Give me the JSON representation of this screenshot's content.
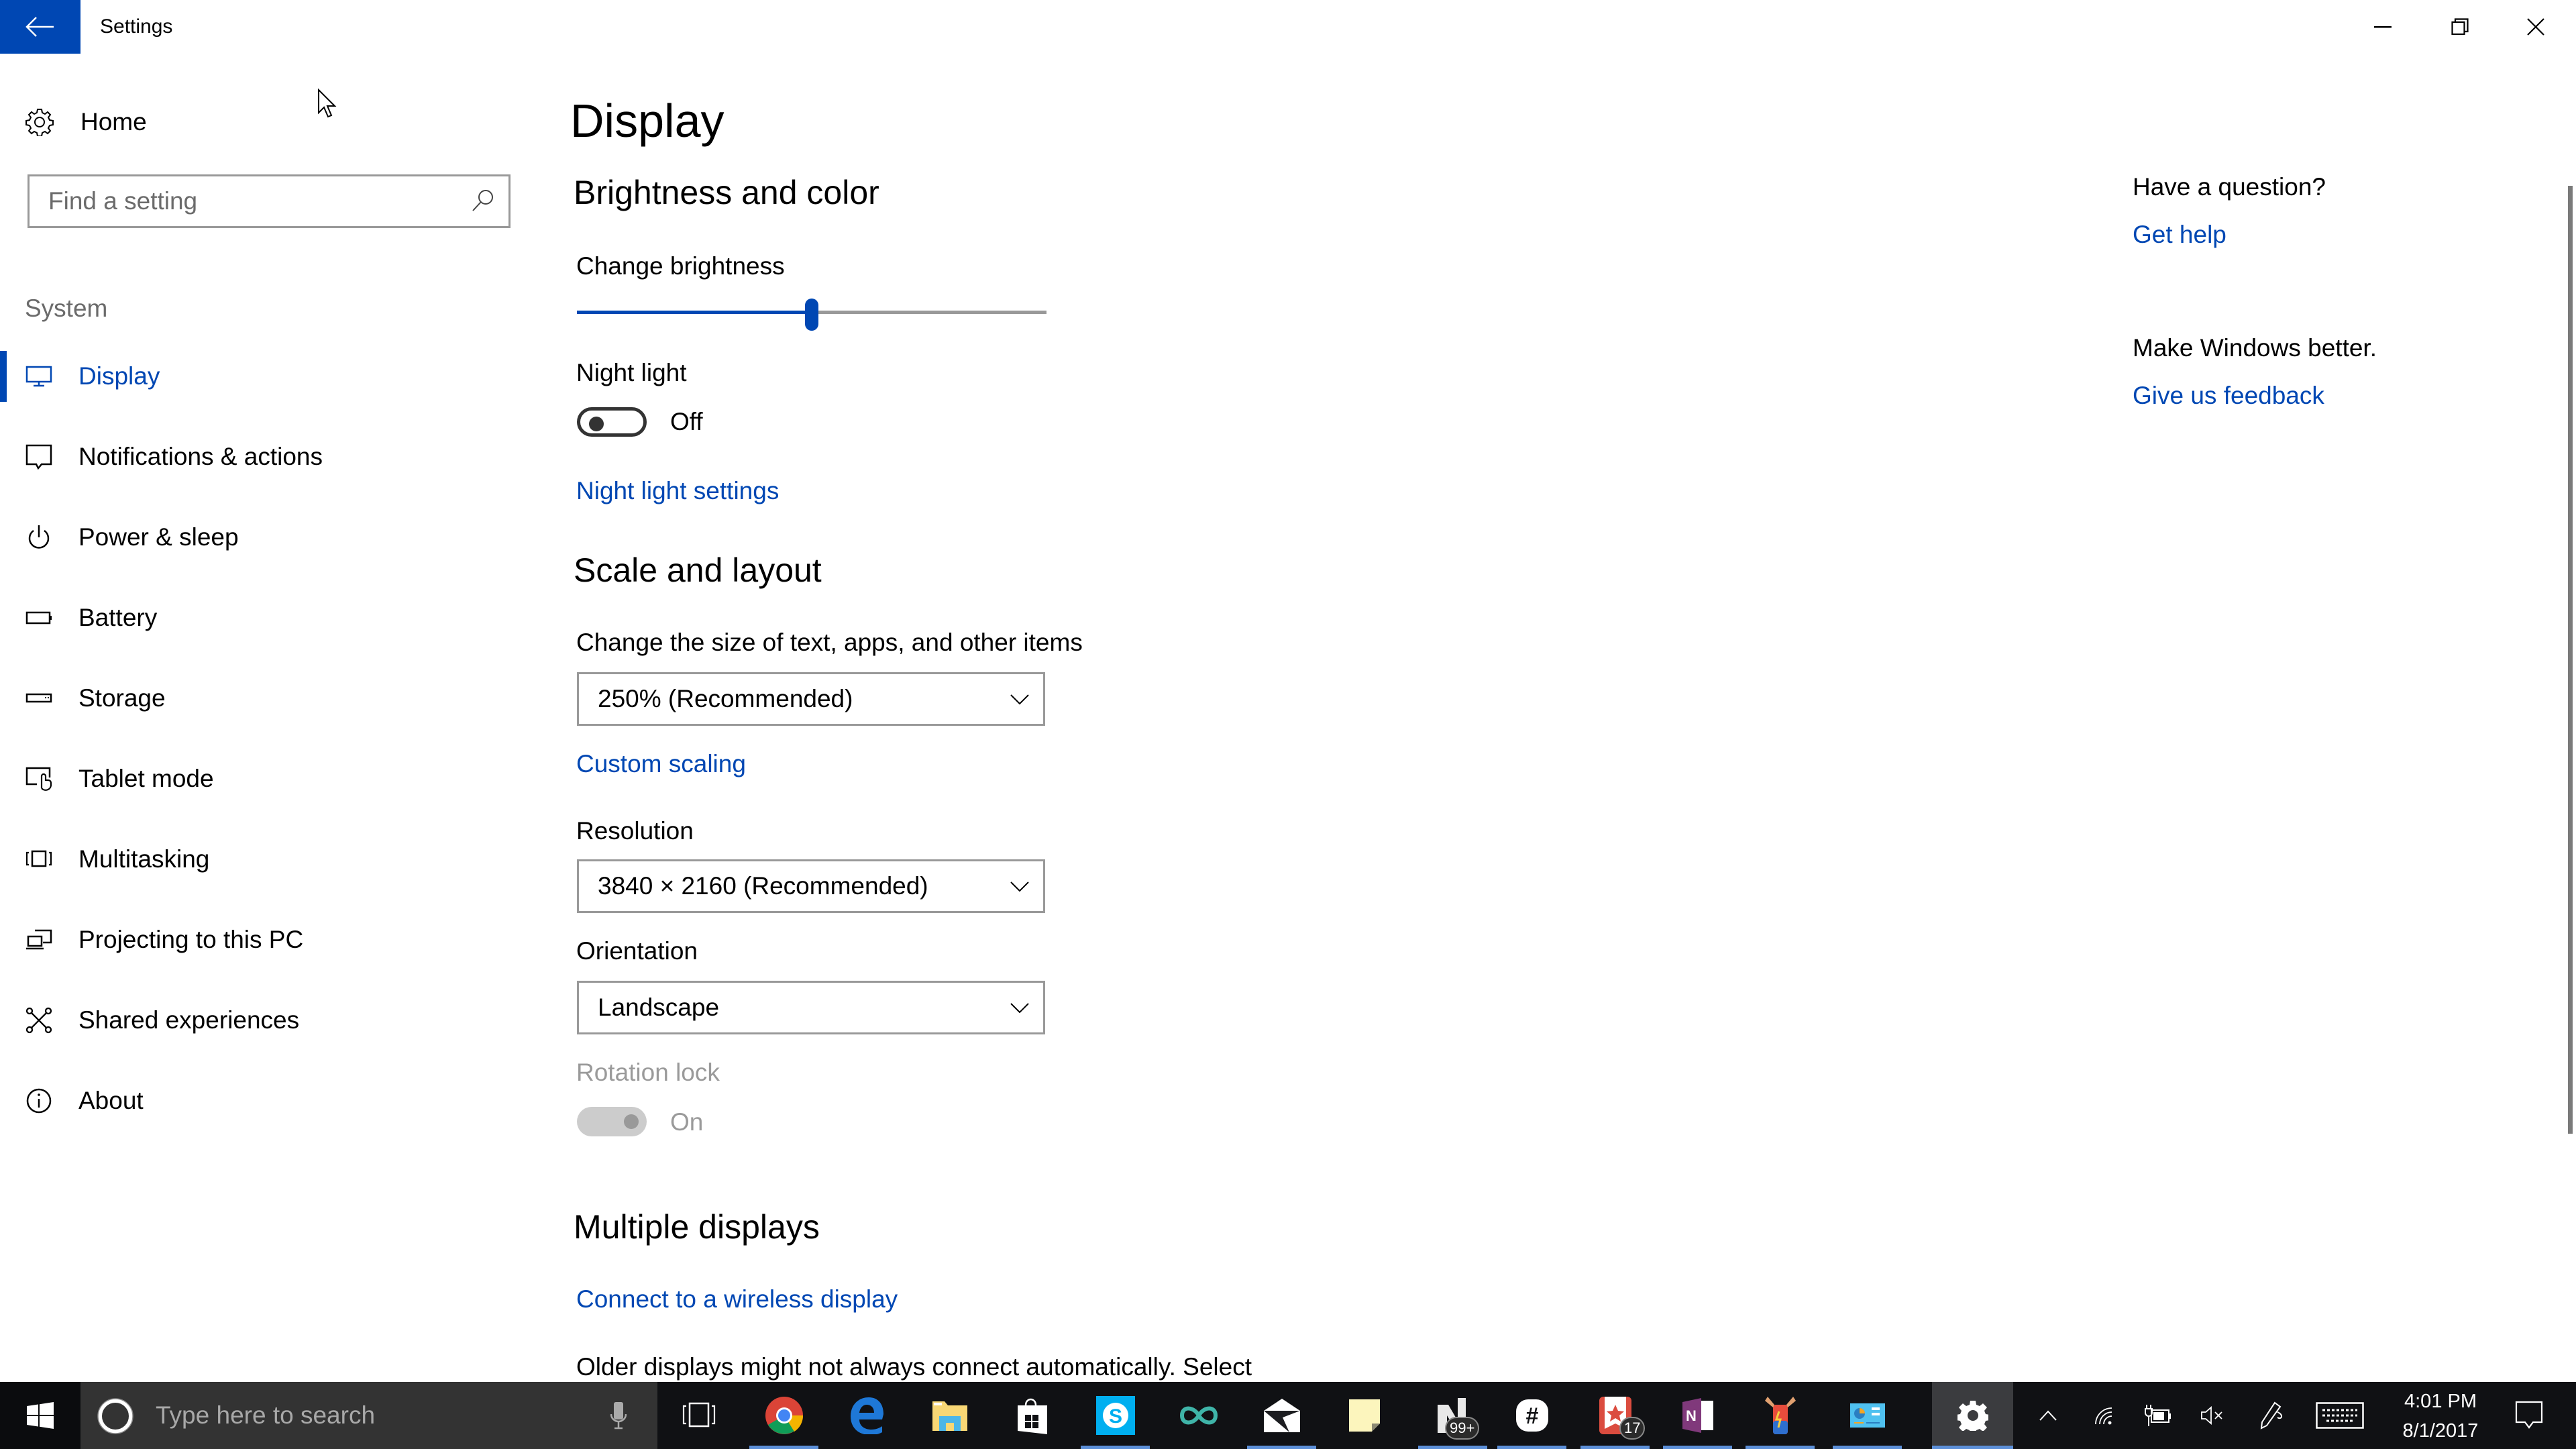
{
  "window": {
    "title": "Settings",
    "controls": {
      "minimize": "minimize-icon",
      "restore": "restore-icon",
      "close": "close-icon"
    }
  },
  "sidebar": {
    "home_label": "Home",
    "search_placeholder": "Find a setting",
    "section_label": "System",
    "items": [
      {
        "label": "Display",
        "icon": "monitor-icon",
        "active": true
      },
      {
        "label": "Notifications & actions",
        "icon": "notification-icon",
        "active": false
      },
      {
        "label": "Power & sleep",
        "icon": "power-icon",
        "active": false
      },
      {
        "label": "Battery",
        "icon": "battery-icon",
        "active": false
      },
      {
        "label": "Storage",
        "icon": "storage-icon",
        "active": false
      },
      {
        "label": "Tablet mode",
        "icon": "tablet-mode-icon",
        "active": false
      },
      {
        "label": "Multitasking",
        "icon": "multitasking-icon",
        "active": false
      },
      {
        "label": "Projecting to this PC",
        "icon": "projecting-icon",
        "active": false
      },
      {
        "label": "Shared experiences",
        "icon": "shared-experiences-icon",
        "active": false
      },
      {
        "label": "About",
        "icon": "info-icon",
        "active": false
      }
    ]
  },
  "main": {
    "title": "Display",
    "brightness_section": {
      "heading": "Brightness and color",
      "brightness_label": "Change brightness",
      "brightness_value_percent": 50,
      "night_light_label": "Night light",
      "night_light_state": "Off",
      "night_light_on": false,
      "night_light_settings_link": "Night light settings"
    },
    "scale_section": {
      "heading": "Scale and layout",
      "scale_label": "Change the size of text, apps, and other items",
      "scale_value": "250% (Recommended)",
      "custom_scaling_link": "Custom scaling",
      "resolution_label": "Resolution",
      "resolution_value": "3840 × 2160 (Recommended)",
      "orientation_label": "Orientation",
      "orientation_value": "Landscape",
      "rotation_lock_label": "Rotation lock",
      "rotation_lock_state": "On",
      "rotation_lock_on": true,
      "rotation_lock_disabled": true
    },
    "multiple_displays_section": {
      "heading": "Multiple displays",
      "wireless_link": "Connect to a wireless display",
      "description": "Older displays might not always connect automatically. Select"
    }
  },
  "help_panel": {
    "question": "Have a question?",
    "get_help_link": "Get help",
    "feedback_prompt": "Make Windows better.",
    "feedback_link": "Give us feedback"
  },
  "taskbar": {
    "search_placeholder": "Type here to search",
    "apps": [
      {
        "name": "chrome",
        "running": true,
        "active": false
      },
      {
        "name": "edge",
        "running": false,
        "active": false
      },
      {
        "name": "file-explorer",
        "running": false,
        "active": false
      },
      {
        "name": "store",
        "running": false,
        "active": false
      },
      {
        "name": "skype",
        "running": true,
        "active": false
      },
      {
        "name": "infinity-app",
        "running": false,
        "active": false
      },
      {
        "name": "mail",
        "running": true,
        "active": false
      },
      {
        "name": "sticky-notes",
        "running": false,
        "active": false
      },
      {
        "name": "news-app",
        "running": true,
        "active": false,
        "badge": "99+"
      },
      {
        "name": "slack",
        "running": true,
        "active": false
      },
      {
        "name": "wunderlist",
        "running": true,
        "active": false,
        "badge": "17"
      },
      {
        "name": "onenote",
        "running": true,
        "active": false
      },
      {
        "name": "battery-app",
        "running": true,
        "active": false
      },
      {
        "name": "control-panel",
        "running": true,
        "active": false
      },
      {
        "name": "settings",
        "running": true,
        "active": true
      }
    ],
    "clock": {
      "time": "4:01 PM",
      "date": "8/1/2017"
    }
  },
  "colors": {
    "accent": "#0047b3",
    "taskbar_bg": "#101114",
    "search_bg": "#333333",
    "running_indicator": "#5c8fd8"
  }
}
